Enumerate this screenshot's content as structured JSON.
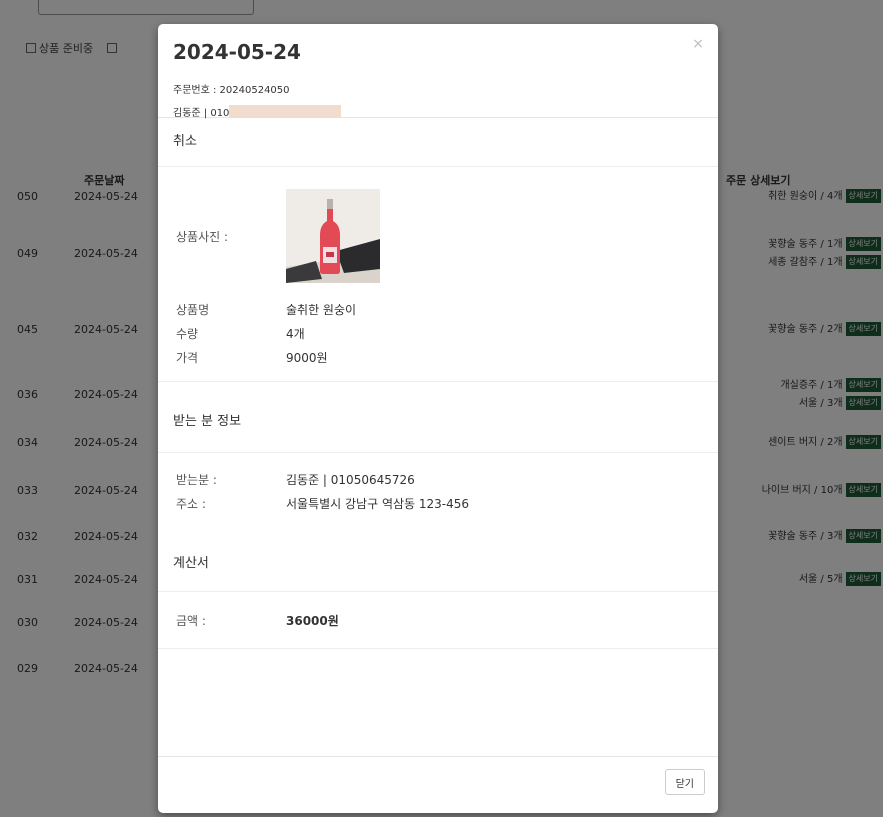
{
  "background": {
    "filters": [
      "상품 준비중",
      ""
    ],
    "header_date": "주문날짜",
    "header_detail": "주문 상세보기",
    "detail_button": "상세보기",
    "rows": [
      {
        "num": "050",
        "date": "2024-05-24",
        "items": [
          "취한 원숭이 / 4개"
        ]
      },
      {
        "num": "049",
        "date": "2024-05-24",
        "items": [
          "꽃향술 동주 / 1개",
          "세종 갈참주 / 1개"
        ]
      },
      {
        "num": "045",
        "date": "2024-05-24",
        "items": [
          "꽃향술 동주 / 2개"
        ]
      },
      {
        "num": "036",
        "date": "2024-05-24",
        "items": [
          "개실증주 / 1개",
          "서울 / 3개"
        ]
      },
      {
        "num": "034",
        "date": "2024-05-24",
        "items": [
          "센이트 버지 / 2개"
        ]
      },
      {
        "num": "033",
        "date": "2024-05-24",
        "items": [
          "나이브 버지 / 10개"
        ]
      },
      {
        "num": "032",
        "date": "2024-05-24",
        "items": [
          "꽃향술 동주 / 3개"
        ]
      },
      {
        "num": "031",
        "date": "2024-05-24",
        "items": [
          "서울 / 5개"
        ]
      },
      {
        "num": "030",
        "date": "2024-05-24",
        "items": []
      },
      {
        "num": "029",
        "date": "2024-05-24",
        "items": []
      }
    ]
  },
  "modal": {
    "title": "2024-05-24",
    "close_icon": "×",
    "order_number": "주문번호 : 20240524050",
    "orderer": "김동준 | 010",
    "status_section": "취소",
    "product": {
      "photo_label": "상품사진 :",
      "name_label": "상품명",
      "name": "술취한 원숭이",
      "qty_label": "수량",
      "qty": "4개",
      "price_label": "가격",
      "price": "9000원"
    },
    "recipient_section": "받는 분 정보",
    "recipient": {
      "name_label": "받는분 :",
      "name": "김동준 | 01050645726",
      "address_label": "주소 :",
      "address": "서울특별시 강남구 역삼동 123-456"
    },
    "invoice_section": "계산서",
    "invoice": {
      "amount_label": "금액 :",
      "amount": "36000원"
    },
    "close_button": "닫기"
  }
}
